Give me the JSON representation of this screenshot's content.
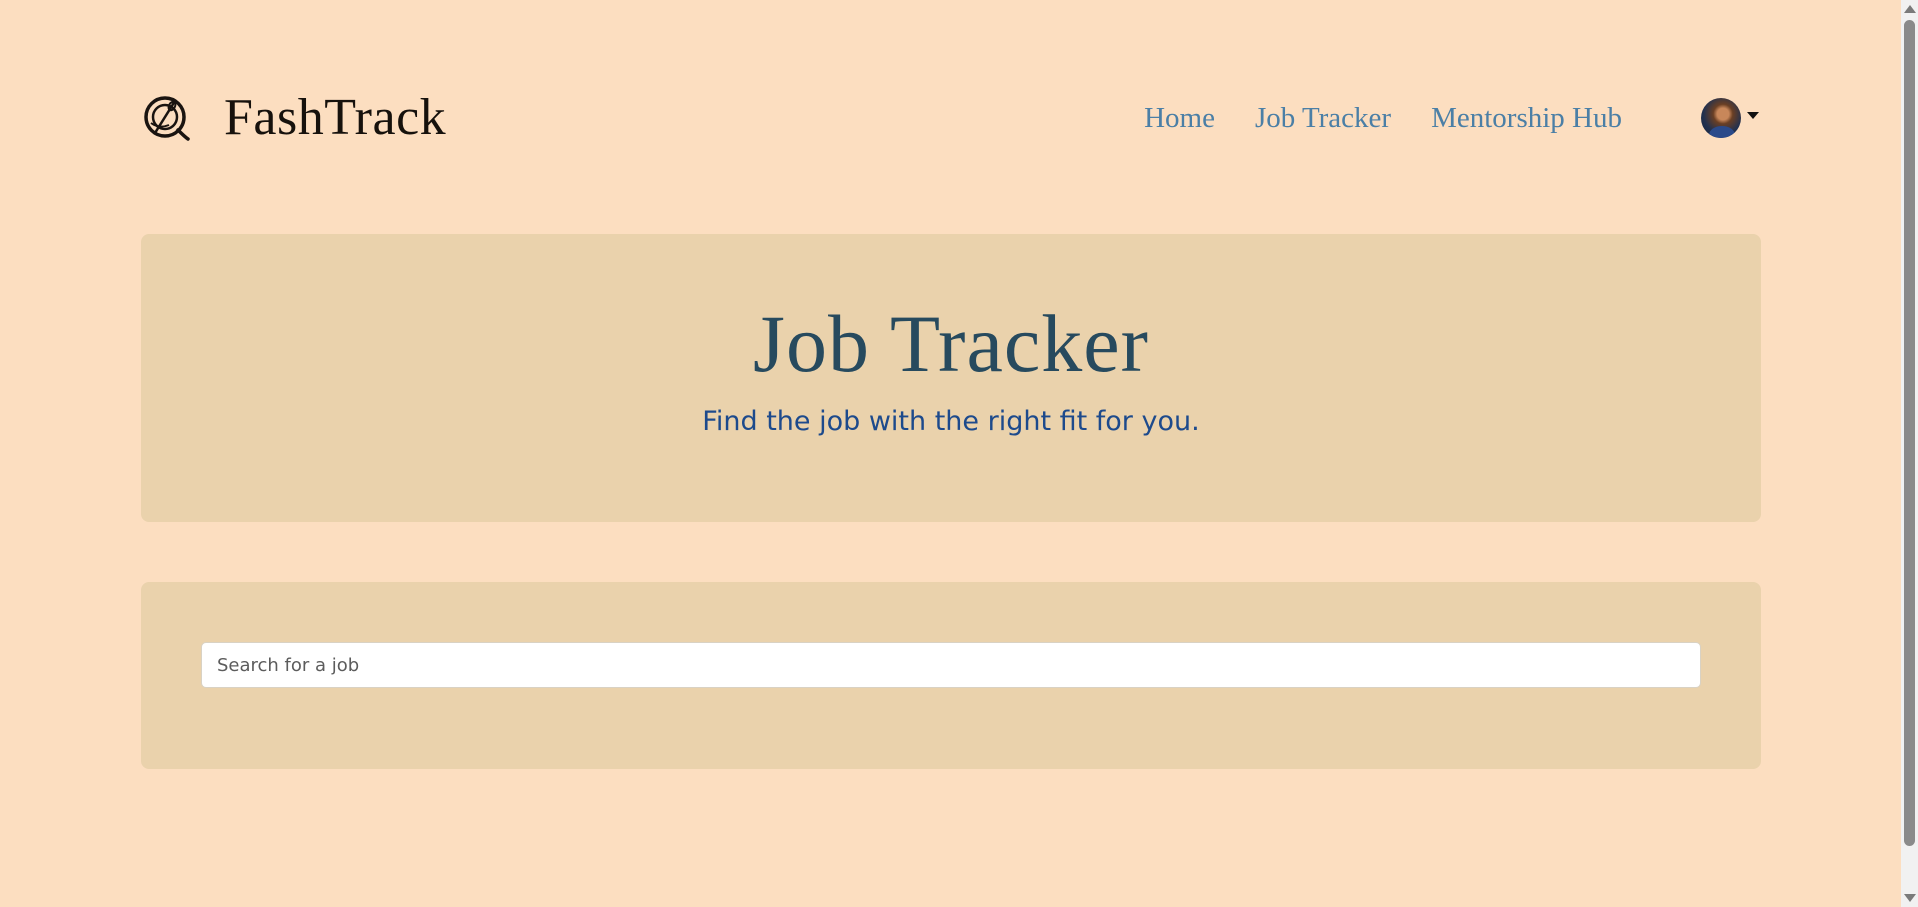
{
  "brand": {
    "name": "FashTrack",
    "logo_icon": "needle-thread-icon"
  },
  "nav": {
    "items": [
      {
        "label": "Home"
      },
      {
        "label": "Job Tracker"
      },
      {
        "label": "Mentorship Hub"
      }
    ],
    "link_color": "#4b7fa6"
  },
  "user": {
    "avatar_icon": "avatar",
    "menu_icon": "caret-down-icon"
  },
  "hero": {
    "title": "Job Tracker",
    "subtitle": "Find the job with the right fit for you."
  },
  "search": {
    "placeholder": "Search for a job",
    "value": ""
  },
  "colors": {
    "page_background": "#fcdec0",
    "panel_background": "#ead2ac",
    "title_color": "#274a5e",
    "subtitle_color": "#1d4a8c"
  }
}
